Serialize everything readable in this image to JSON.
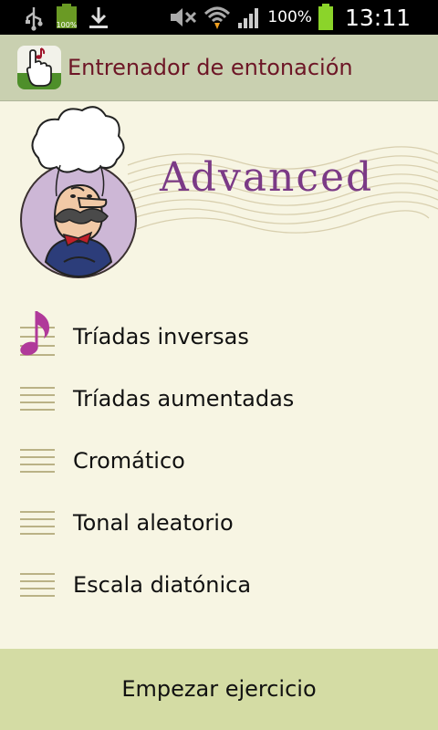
{
  "status_bar": {
    "battery_small_text": "100%",
    "battery_text": "100%",
    "time": "13:11",
    "icons": [
      "usb-icon",
      "battery-charging-icon",
      "download-icon",
      "mute-icon",
      "wifi-icon",
      "signal-icon",
      "battery-icon"
    ]
  },
  "app_bar": {
    "title": "Entrenador de entonación",
    "icon": "hand-music-note-icon"
  },
  "hero": {
    "level_text": "Advanced",
    "character": "professor-character"
  },
  "exercises": [
    {
      "label": "Tríadas inversas",
      "icon": "music-note-icon",
      "selected": true
    },
    {
      "label": "Tríadas aumentadas",
      "icon": "staff-lines-icon",
      "selected": false
    },
    {
      "label": "Cromático",
      "icon": "staff-lines-icon",
      "selected": false
    },
    {
      "label": "Tonal aleatorio",
      "icon": "staff-lines-icon",
      "selected": false
    },
    {
      "label": "Escala diatónica",
      "icon": "staff-lines-icon",
      "selected": false
    }
  ],
  "start_button": {
    "label": "Empezar ejercicio"
  },
  "colors": {
    "background": "#f7f5e3",
    "app_bar": "#c9d0b0",
    "title": "#6d1626",
    "accent_note": "#b0399a",
    "staff": "#a59c68",
    "button": "#d4dca4"
  }
}
